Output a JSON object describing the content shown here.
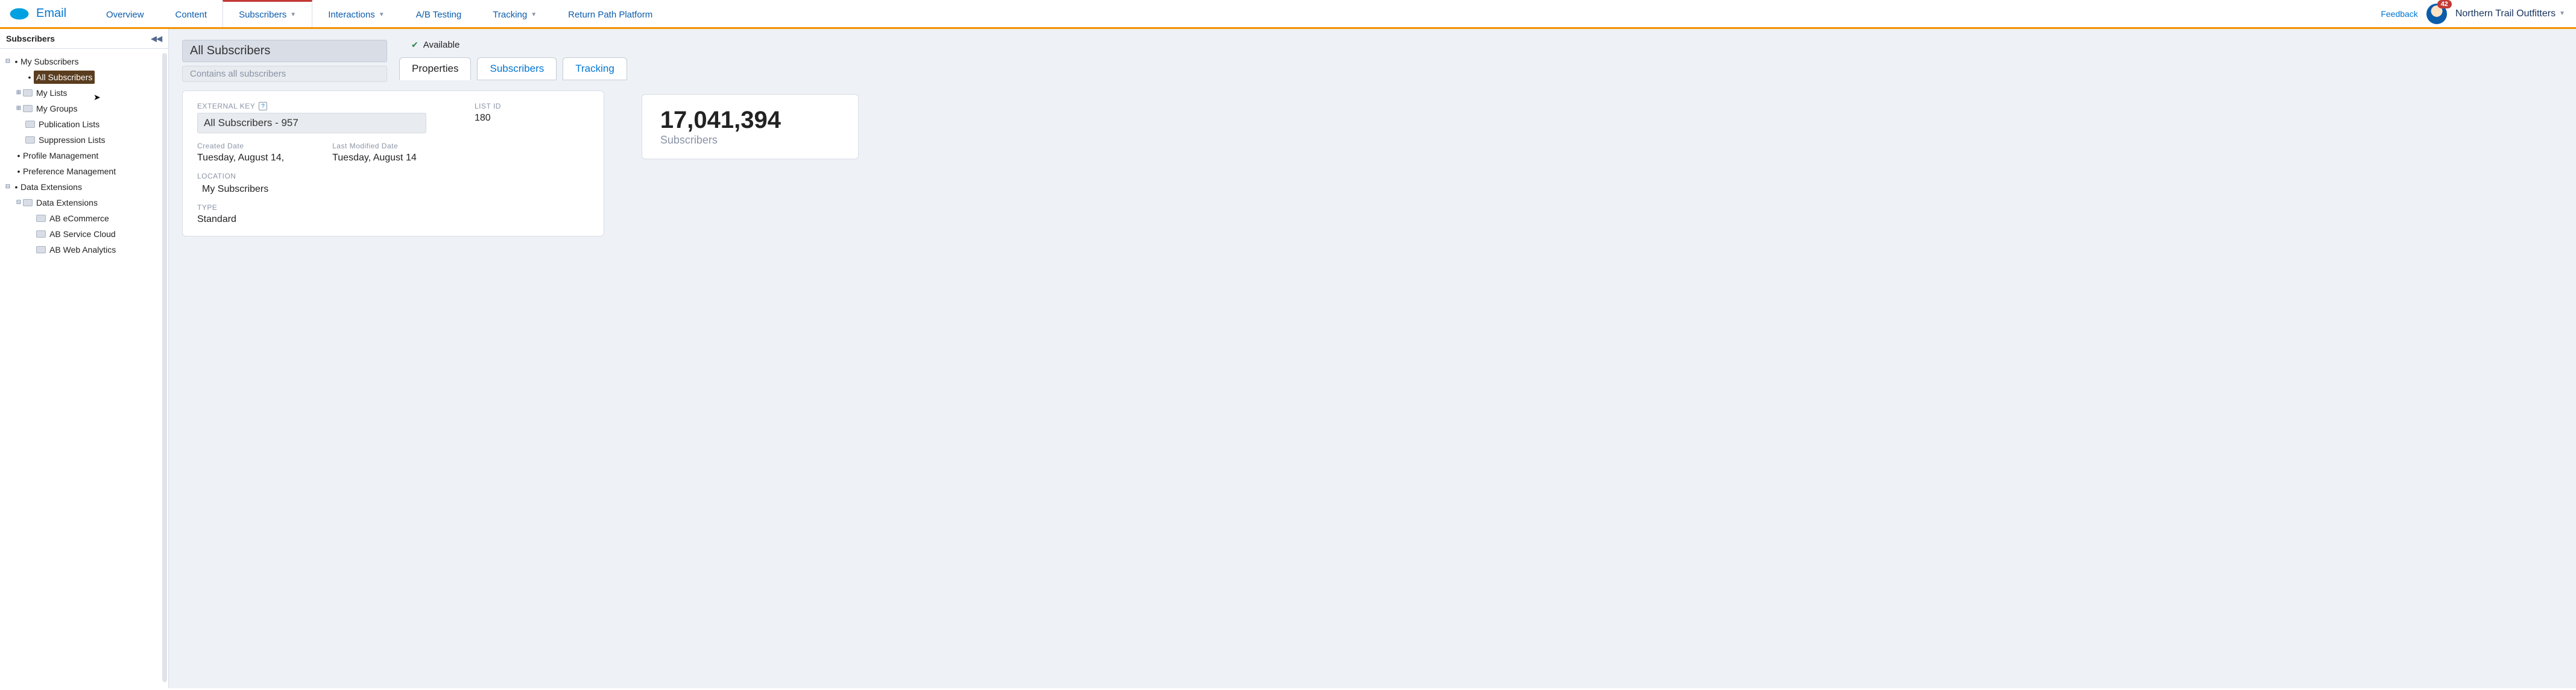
{
  "header": {
    "app_name": "Email",
    "tabs": [
      "Overview",
      "Content",
      "Subscribers",
      "Interactions",
      "A/B Testing",
      "Tracking",
      "Return Path Platform"
    ],
    "active_tab_index": 2,
    "tab_has_dropdown": [
      false,
      false,
      true,
      true,
      false,
      true,
      false
    ],
    "feedback": "Feedback",
    "badge_count": "42",
    "account_name": "Northern Trail Outfitters"
  },
  "sidebar": {
    "title": "Subscribers",
    "tree": {
      "my_subscribers": "My Subscribers",
      "all_subscribers": "All Subscribers",
      "my_lists": "My Lists",
      "my_groups": "My Groups",
      "publication_lists": "Publication Lists",
      "suppression_lists": "Suppression Lists",
      "profile_mgmt": "Profile Management",
      "preference_mgmt": "Preference Management",
      "data_ext_root": "Data Extensions",
      "data_ext_folder": "Data Extensions",
      "ab_ecommerce": "AB eCommerce",
      "ab_service": "AB Service Cloud",
      "ab_web": "AB Web Analytics"
    }
  },
  "content": {
    "title": "All Subscribers",
    "subtitle": "Contains all subscribers",
    "status": "Available",
    "tabs": [
      "Properties",
      "Subscribers",
      "Tracking"
    ],
    "active_ctab": 0,
    "fields": {
      "external_key_label": "EXTERNAL KEY",
      "external_key_value": "All Subscribers - 957",
      "list_id_label": "LIST ID",
      "list_id_value": "180",
      "created_label": "Created Date",
      "created_value": "Tuesday, August 14,",
      "modified_label": "Last Modified Date",
      "modified_value": "Tuesday, August 14",
      "location_label": "LOCATION",
      "location_value": "My Subscribers",
      "type_label": "TYPE",
      "type_value": "Standard"
    },
    "stats": {
      "count": "17,041,394",
      "label": "Subscribers"
    }
  }
}
